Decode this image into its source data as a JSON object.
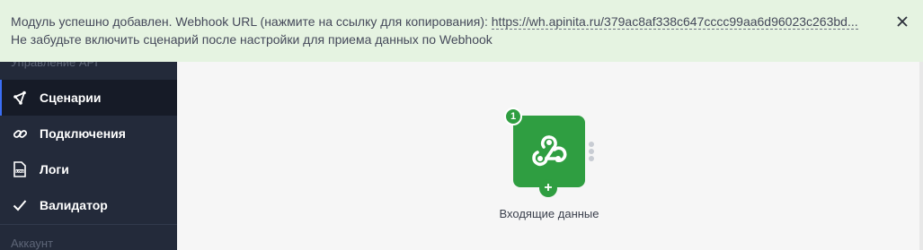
{
  "notice": {
    "text_before": "Модуль успешно добавлен. Webhook URL (нажмите на ссылку для копирования): ",
    "url": "https://wh.apinita.ru/379ac8af338c647cccc99aa6d96023c263bd...",
    "text_after": " Не забудьте включить сценарий после настройки для приема данных по Webhook",
    "close_icon": "close-icon"
  },
  "sidebar": {
    "section_top": "Управление API",
    "section_bottom": "Аккаунт",
    "items": [
      {
        "label": "Сценарии",
        "icon": "share-icon",
        "active": true
      },
      {
        "label": "Подключения",
        "icon": "link-icon",
        "active": false
      },
      {
        "label": "Логи",
        "icon": "log-icon",
        "active": false
      },
      {
        "label": "Валидатор",
        "icon": "check-icon",
        "active": false
      }
    ]
  },
  "canvas": {
    "node": {
      "badge": "1",
      "label": "Входящие данные",
      "icon": "webhook-icon",
      "color": "#2f9e41"
    }
  }
}
